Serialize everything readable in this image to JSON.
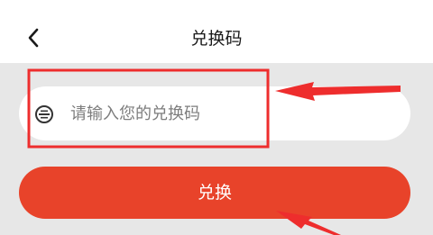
{
  "header": {
    "title": "兑换码",
    "back_icon": "chevron-left-icon"
  },
  "redeem_form": {
    "input_placeholder": "请输入您的兑换码",
    "input_value": "",
    "input_icon": "coupon-icon",
    "submit_label": "兑换"
  },
  "colors": {
    "accent": "#e8432a",
    "annotation": "#ee2d2d",
    "page_background": "#e7e7e7"
  }
}
